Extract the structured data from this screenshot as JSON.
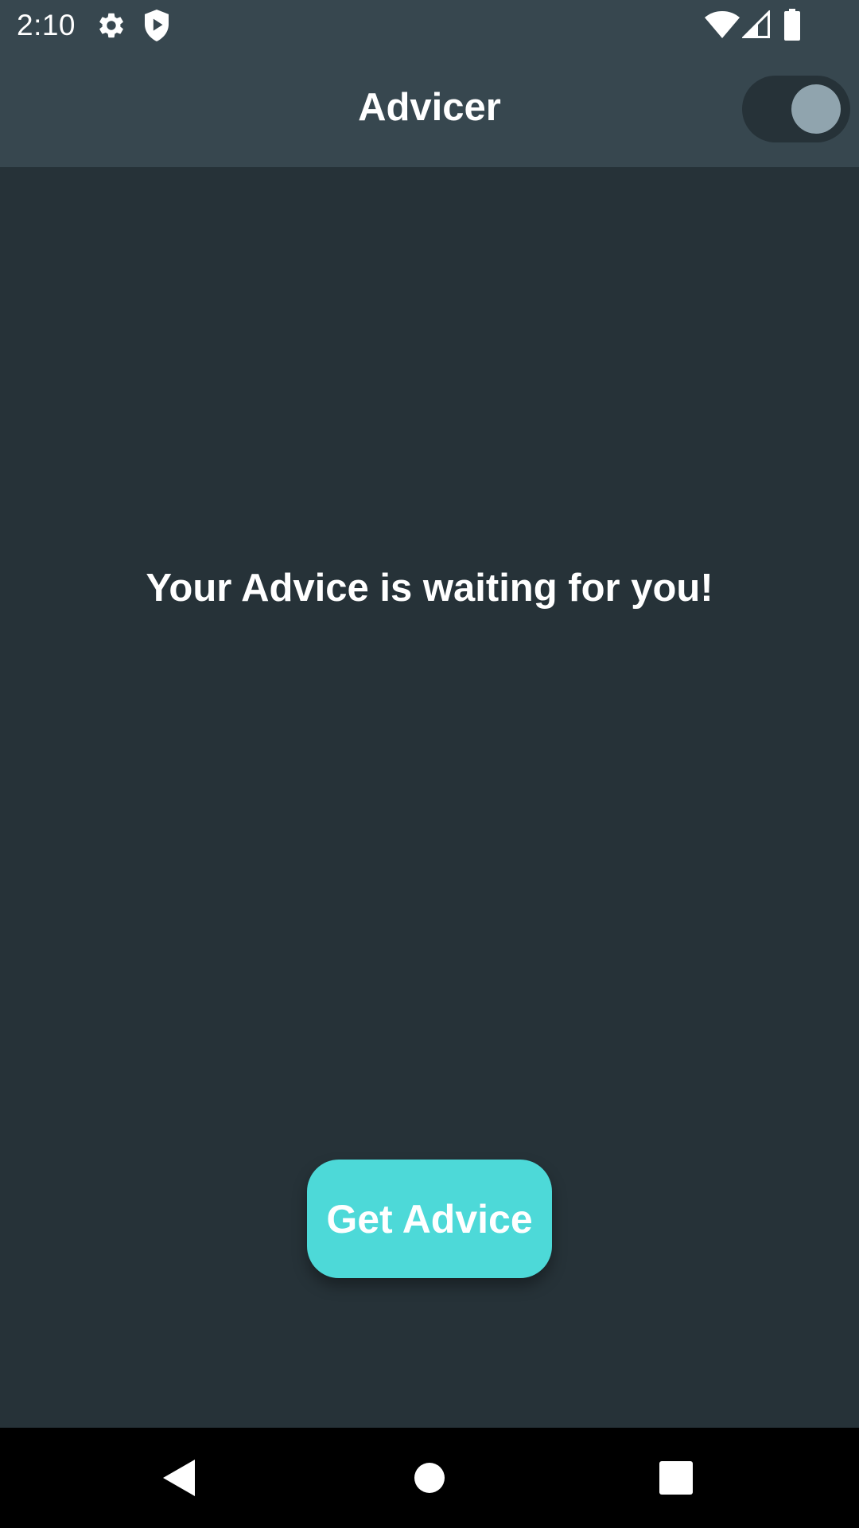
{
  "status_bar": {
    "time": "2:10",
    "icons": [
      "gear-icon",
      "shield-play-icon",
      "wifi-icon",
      "cell-signal-icon",
      "battery-icon"
    ]
  },
  "app_bar": {
    "title": "Advicer",
    "theme_toggle": {
      "on": true
    }
  },
  "main": {
    "advice_text": "Your Advice is waiting for you!",
    "get_advice_label": "Get Advice"
  },
  "nav_bar": {
    "buttons": [
      "back-icon",
      "home-icon",
      "recents-icon"
    ]
  },
  "colors": {
    "background": "#263238",
    "app_bar": "#37474F",
    "accent_button": "#4DD9D8",
    "toggle_thumb": "#90A4AE",
    "text": "#FFFFFF",
    "nav_bar": "#000000"
  }
}
